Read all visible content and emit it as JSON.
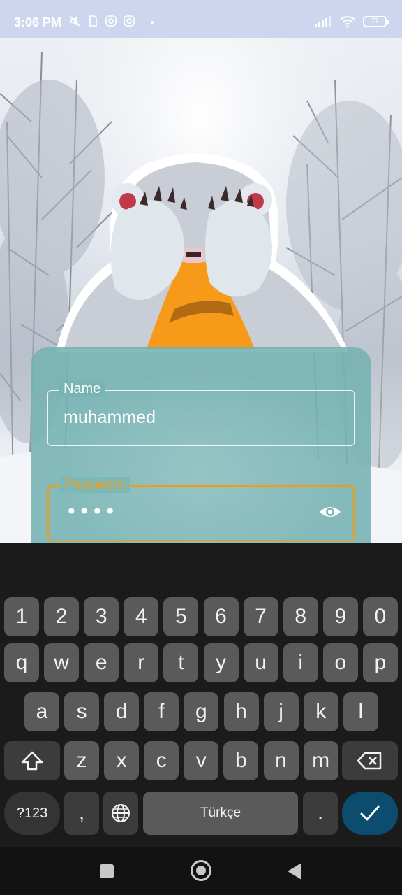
{
  "status_bar": {
    "time": "3:06 PM",
    "battery": "77",
    "icons": [
      "mute-icon",
      "sd-card-icon",
      "instagram-icon",
      "instagram-icon",
      "signal-icon",
      "wifi-icon",
      "battery-icon"
    ]
  },
  "login": {
    "name_label": "Name",
    "name_value": "muhammed",
    "password_label": "Password",
    "password_value": "••••",
    "accent_color": "#f39c12"
  },
  "keyboard": {
    "row_numbers": [
      "1",
      "2",
      "3",
      "4",
      "5",
      "6",
      "7",
      "8",
      "9",
      "0"
    ],
    "row1": [
      "q",
      "w",
      "e",
      "r",
      "t",
      "y",
      "u",
      "i",
      "o",
      "p"
    ],
    "row2": [
      "a",
      "s",
      "d",
      "f",
      "g",
      "h",
      "j",
      "k",
      "l"
    ],
    "row3": [
      "z",
      "x",
      "c",
      "v",
      "b",
      "n",
      "m"
    ],
    "sym_label": "?123",
    "comma_label": ",",
    "space_label": "Türkçe",
    "period_label": ".",
    "enter_color": "#0c4c6e"
  }
}
